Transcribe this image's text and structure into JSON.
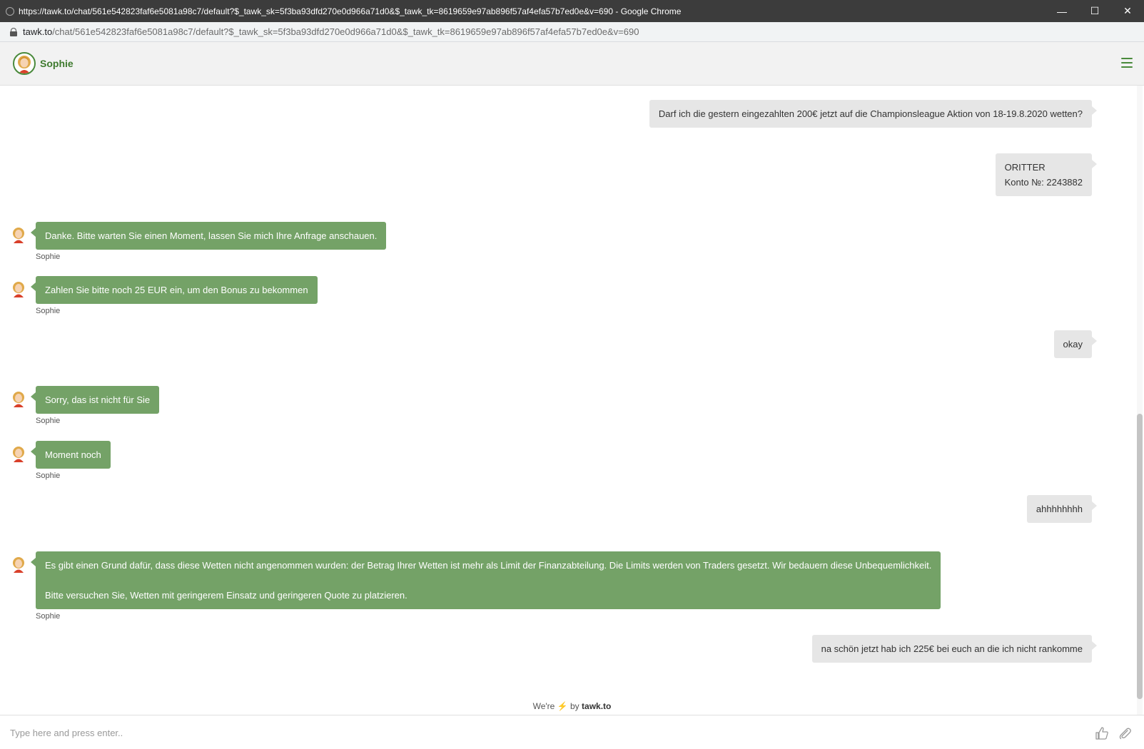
{
  "browser": {
    "title": "https://tawk.to/chat/561e542823faf6e5081a98c7/default?$_tawk_sk=5f3ba93dfd270e0d966a71d0&$_tawk_tk=8619659e97ab896f57af4efa57b7ed0e&v=690 - Google Chrome",
    "url_host": "tawk.to",
    "url_path": "/chat/561e542823faf6e5081a98c7/default?$_tawk_sk=5f3ba93dfd270e0d966a71d0&$_tawk_tk=8619659e97ab896f57af4efa57b7ed0e&v=690",
    "minimize": "—",
    "maximize": "☐",
    "close": "✕"
  },
  "header": {
    "agent_name": "Sophie"
  },
  "messages": {
    "m1": "Darf ich die gestern eingezahlten 200€ jetzt auf die Championsleague Aktion von 18-19.8.2020 wetten?",
    "m2_line1": "ORITTER",
    "m2_line2": "Konto №: 2243882",
    "m3": "Danke. Bitte warten Sie einen Moment, lassen Sie mich Ihre Anfrage anschauen.",
    "m4": "Zahlen Sie bitte noch 25 EUR ein, um den Bonus zu bekommen",
    "m5": "okay",
    "m6": "Sorry, das ist nicht für Sie",
    "m7": "Moment noch",
    "m8": "ahhhhhhhh",
    "m9_line1": "Es gibt einen Grund dafür, dass diese Wetten nicht angenommen wurden: der Betrag Ihrer Wetten ist mehr als Limit der Finanzabteilung. Die Limits werden von Traders gesetzt. Wir bedauern diese Unbequemlichkeit.",
    "m9_line2": "Bitte versuchen Sie, Wetten mit geringerem Einsatz und geringeren Quote zu platzieren.",
    "m10": "na schön jetzt hab ich 225€ bei euch an die ich nicht rankomme",
    "sender": "Sophie"
  },
  "footer": {
    "powered_prefix": "We're",
    "powered_by": "by",
    "powered_brand": "tawk.to",
    "input_placeholder": "Type here and press enter.."
  },
  "icons": {
    "thumbs": "thumbs-up-icon",
    "attach": "paperclip-icon",
    "menu": "hamburger-menu-icon",
    "bolt": "lightning-icon"
  },
  "colors": {
    "agent_bubble": "#74a267",
    "visitor_bubble": "#e6e6e6",
    "brand_green": "#3e7a2e"
  }
}
